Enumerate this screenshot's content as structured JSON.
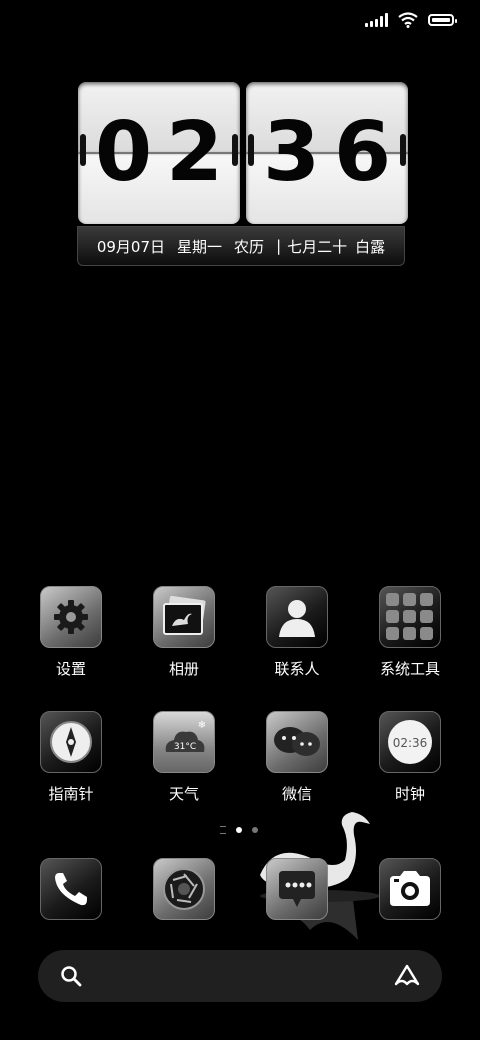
{
  "status_bar": {
    "signal": "signal-icon",
    "wifi": "wifi-icon",
    "battery": "battery-icon"
  },
  "clock_widget": {
    "hour": "02",
    "minute": "36",
    "date": "09月07日",
    "weekday": "星期一",
    "lunar": "农历",
    "separator": "|",
    "lunar_date": "七月二十",
    "solar_term": "白露"
  },
  "apps": [
    {
      "label": "设置",
      "icon": "gear-icon"
    },
    {
      "label": "相册",
      "icon": "photo-album-icon"
    },
    {
      "label": "联系人",
      "icon": "contacts-icon"
    },
    {
      "label": "系统工具",
      "icon": "system-tools-folder-icon"
    },
    {
      "label": "指南针",
      "icon": "compass-icon"
    },
    {
      "label": "天气",
      "icon": "weather-icon",
      "temp": "31°C"
    },
    {
      "label": "微信",
      "icon": "wechat-icon"
    },
    {
      "label": "时钟",
      "icon": "clock-icon",
      "time": "02:36"
    }
  ],
  "dock": [
    {
      "name": "phone",
      "icon": "phone-icon"
    },
    {
      "name": "browser",
      "icon": "camera-aperture-icon"
    },
    {
      "name": "messages",
      "icon": "message-icon"
    },
    {
      "name": "camera",
      "icon": "camera-icon"
    }
  ],
  "page_indicator": {
    "pages": 2,
    "current": 1
  },
  "search_bar": {
    "search_icon": "search-icon",
    "assistant_icon": "assistant-icon"
  }
}
